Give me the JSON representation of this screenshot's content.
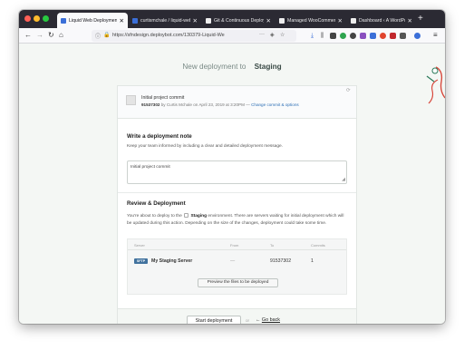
{
  "browser": {
    "tabs": [
      {
        "label": "Liquid Web Deployment: De",
        "active": true,
        "favicon_color": "#3b6fd8"
      },
      {
        "label": "curtismchale / liquid-web",
        "active": false,
        "favicon_color": "#3b6fd8"
      },
      {
        "label": "Git & Continuous Deploym",
        "active": false,
        "favicon_color": "#eeeeee"
      },
      {
        "label": "Managed WooCommerce H",
        "active": false,
        "favicon_color": "#eeeeee"
      },
      {
        "label": "Dashboard ‹ A WordPress site",
        "active": false,
        "favicon_color": "#eeeeee"
      }
    ],
    "tab_close": "✕",
    "new_tab": "+",
    "url": "https://sfndesign.deploybot.com/130379-Liquid-We",
    "nav": {
      "back": "←",
      "forward": "→",
      "reload": "↻",
      "home": "⌂",
      "more": "···",
      "star": "☆",
      "menu": "≡"
    },
    "extension_colors": [
      "#3b6fd8",
      "#555555",
      "#444444",
      "#2ea44f",
      "#444444",
      "#8a4fbf",
      "#3b6fd8",
      "#e0442e",
      "#c1272d",
      "#555555",
      "#3b6fd8",
      "#555555"
    ]
  },
  "page": {
    "heading_prefix": "New deployment to",
    "heading_target": "Staging",
    "commit": {
      "title": "Initial project commit",
      "sha": "91537302",
      "meta": "by Curtis Mchale on April 23, 2019 at 3:20PM —",
      "change_link": "Change commit & options"
    },
    "note_section": {
      "title": "Write a deployment note",
      "description": "Keep your team informed by including a clear and detailed deployment message.",
      "note_value": "Initial project commit"
    },
    "review_section": {
      "title": "Review & Deployment",
      "description_line1": "You're about to deploy to the",
      "environment": "Staging",
      "description_line1_end": "environment. There are servers waiting for initial deployment which",
      "description_line2": "will be updated during this action. Depending on the size of the changes, deployment could take some time."
    },
    "table": {
      "headers": [
        "Server",
        "From",
        "To",
        "Commits"
      ],
      "rows": [
        {
          "badge": "SFTP",
          "server": "My Staging Server",
          "from": "—",
          "to": "91537302",
          "commits": "1"
        }
      ],
      "preview_button": "Preview the files to be deployed"
    },
    "footer": {
      "start_button": "Start deployment",
      "or_text": "or",
      "back_arrow": "←",
      "back_link": "Go back"
    }
  }
}
